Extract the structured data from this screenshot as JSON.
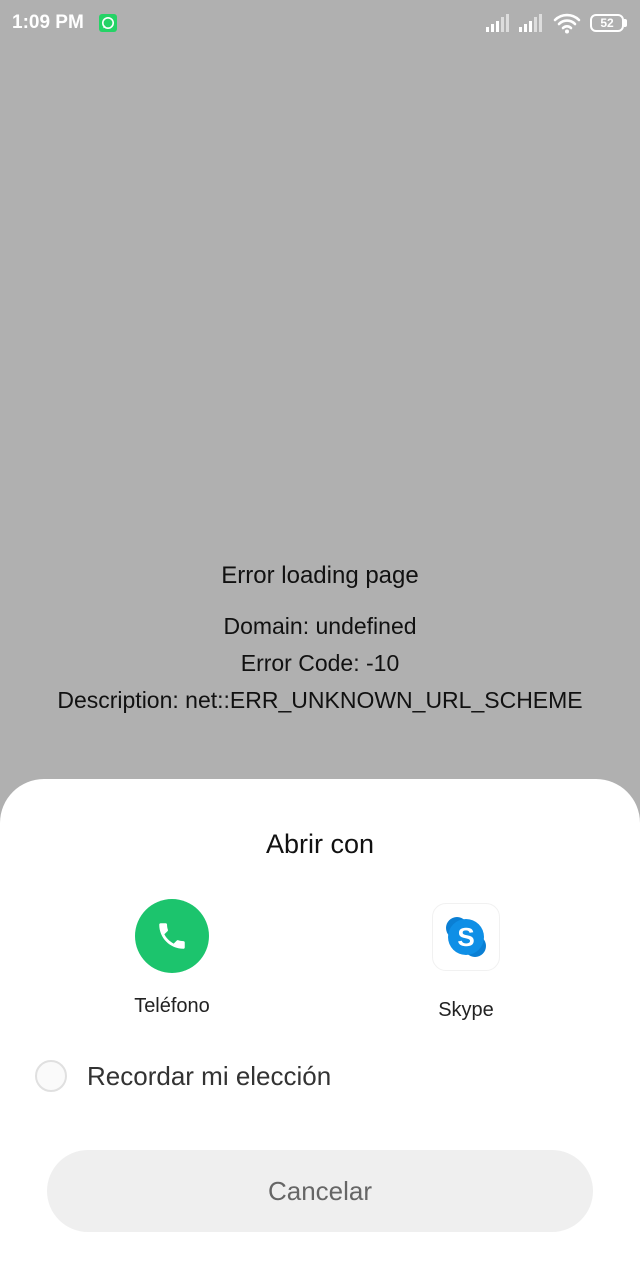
{
  "status_bar": {
    "time": "1:09 PM",
    "battery_level": "52",
    "icons": [
      "whatsapp-notification-icon",
      "signal-icon",
      "signal-icon",
      "wifi-icon",
      "battery-icon"
    ],
    "colors": {
      "whatsapp": "#25d366"
    }
  },
  "error": {
    "title": "Error loading page",
    "domain": "Domain: undefined",
    "code": "Error Code: -10",
    "description": "Description: net::ERR_UNKNOWN_URL_SCHEME"
  },
  "sheet": {
    "title": "Abrir con",
    "apps": [
      {
        "label": "Teléfono",
        "icon": "phone-icon",
        "color": "#1cc46d"
      },
      {
        "label": "Skype",
        "icon": "skype-icon",
        "color": "#0a7fd4"
      }
    ],
    "remember_label": "Recordar mi elección",
    "remember_checked": false,
    "cancel_label": "Cancelar"
  }
}
